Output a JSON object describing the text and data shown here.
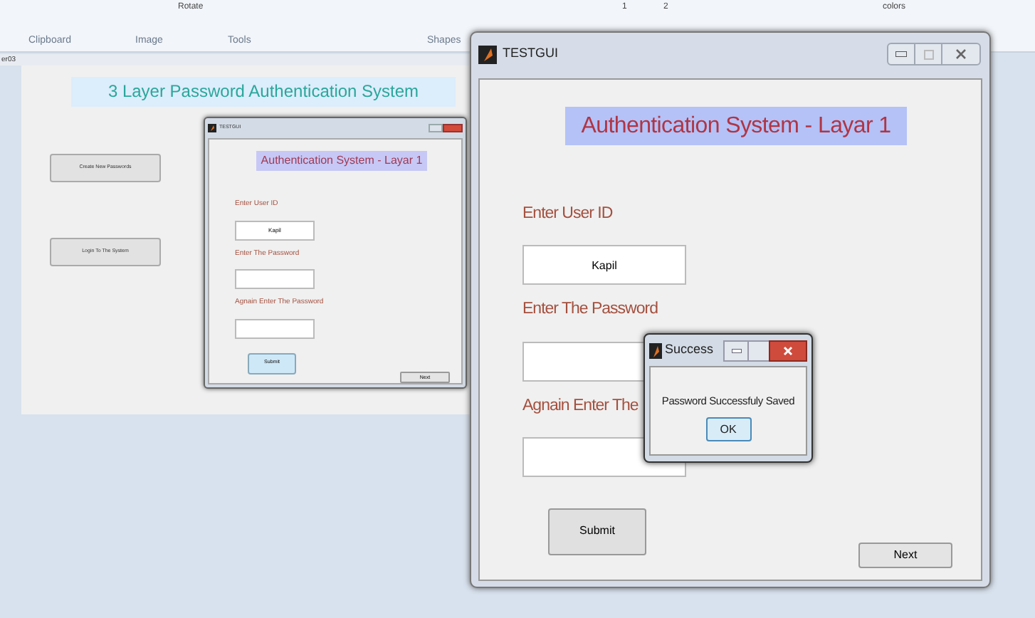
{
  "ribbon": {
    "top_items": [
      "Rotate",
      "1",
      "2",
      "colors"
    ],
    "groups": [
      "Clipboard",
      "Image",
      "Tools",
      "Shapes"
    ]
  },
  "canvas_tab": "er03",
  "main_app": {
    "title": "3 Layer Password Authentication System",
    "buttons": [
      "Create New Passwords",
      "Login To The System"
    ]
  },
  "small_window": {
    "title": "TESTGUI",
    "header": "Authentication System - Layar 1",
    "fields": [
      {
        "label": "Enter User ID",
        "value": "Kapil"
      },
      {
        "label": "Enter The Password"
      },
      {
        "label": "Agnain Enter The Password"
      }
    ],
    "submit": "Submit",
    "next": "Next"
  },
  "main_window": {
    "title": "TESTGUI",
    "header": "Authentication System - Layar 1",
    "fields": [
      {
        "label": "Enter User ID",
        "value": "Kapil"
      },
      {
        "label": "Enter The Password"
      },
      {
        "label": "Agnain Enter The"
      }
    ],
    "submit": "Submit",
    "next": "Next"
  },
  "dialog": {
    "title": "Success",
    "message": "Password Successfuly Saved",
    "button": "OK"
  }
}
